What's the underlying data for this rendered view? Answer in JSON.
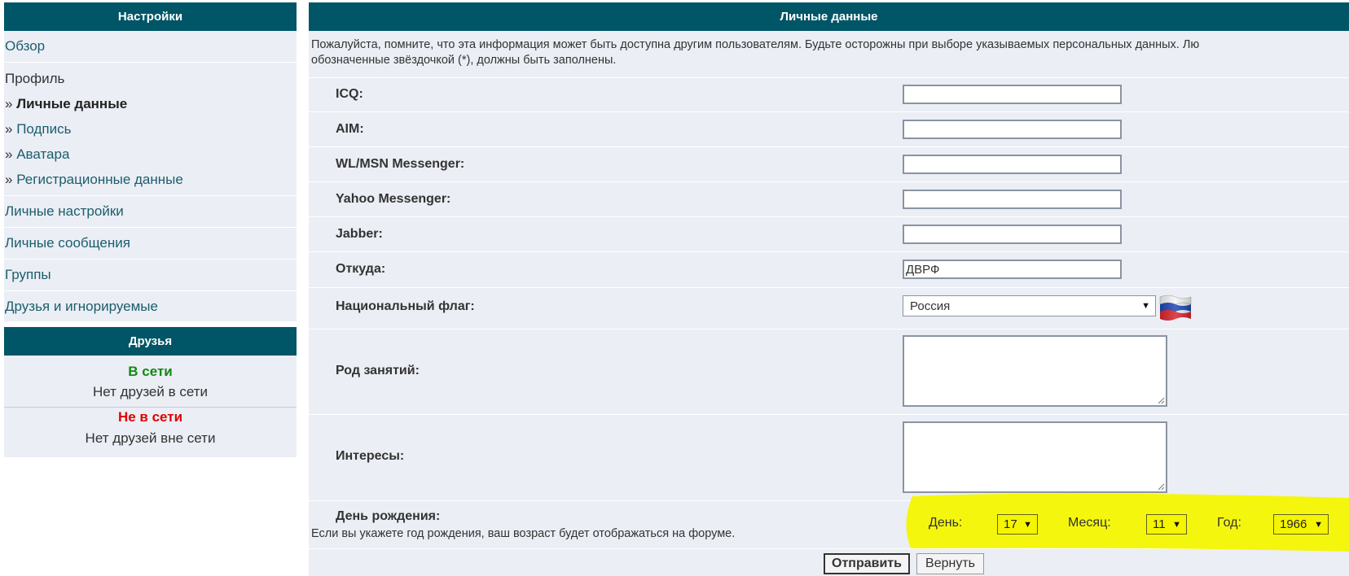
{
  "sidebar": {
    "header": "Настройки",
    "overview": "Обзор",
    "profile": "Профиль",
    "raquo": "»",
    "profile_items": [
      {
        "label": "Личные данные"
      },
      {
        "label": "Подпись"
      },
      {
        "label": "Аватара"
      },
      {
        "label": "Регистрационные данные"
      }
    ],
    "items": [
      {
        "label": "Личные настройки"
      },
      {
        "label": "Личные сообщения"
      },
      {
        "label": "Группы"
      },
      {
        "label": "Друзья и игнорируемые"
      }
    ]
  },
  "friends": {
    "header": "Друзья",
    "online_title": "В сети",
    "online_empty": "Нет друзей в сети",
    "offline_title": "Не в сети",
    "offline_empty": "Нет друзей вне сети"
  },
  "main": {
    "header": "Личные данные",
    "notice_line1": "Пожалуйста, помните, что эта информация может быть доступна другим пользователям. Будьте осторожны при выборе указываемых персональных данных. Лю",
    "notice_line2": "обозначенные звёздочкой (*), должны быть заполнены.",
    "fields": {
      "icq": {
        "label": "ICQ:",
        "value": ""
      },
      "aim": {
        "label": "AIM:",
        "value": ""
      },
      "msn": {
        "label": "WL/MSN Messenger:",
        "value": ""
      },
      "yahoo": {
        "label": "Yahoo Messenger:",
        "value": ""
      },
      "jabber": {
        "label": "Jabber:",
        "value": ""
      },
      "location": {
        "label": "Откуда:",
        "value": "ДВРФ"
      },
      "flag": {
        "label": "Национальный флаг:",
        "value": "Россия",
        "icon": "russia-flag-icon"
      },
      "occupation": {
        "label": "Род занятий:"
      },
      "interests": {
        "label": "Интересы:"
      },
      "birthday": {
        "label": "День рождения:",
        "hint": "Если вы укажете год рождения, ваш возраст будет отображаться на форуме.",
        "day_label": "День:",
        "day": "17",
        "month_label": "Месяц:",
        "month": "11",
        "year_label": "Год:",
        "year": "1966"
      }
    },
    "submit": "Отправить",
    "reset": "Вернуть"
  },
  "colors": {
    "header_bg": "#005566",
    "panel_bg": "#ebeef5",
    "link": "#1b5d6b",
    "online": "#108a10",
    "offline": "#e00000",
    "highlight": "#f5f500"
  }
}
